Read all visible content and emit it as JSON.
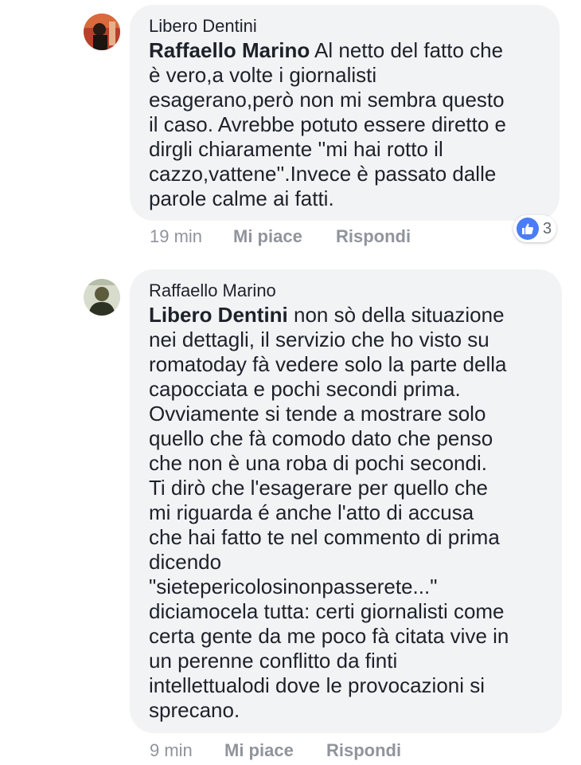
{
  "comments": [
    {
      "author": "Libero Dentini",
      "mention": "Raffaello Marino",
      "text": "Al netto del fatto che\nè vero,a volte i giornalisti\nesagerano,però non mi sembra questo\nil caso. Avrebbe potuto essere diretto e\ndirgli chiaramente ''mi hai rotto il\ncazzo,vattene''.Invece è passato dalle\nparole calme ai fatti.",
      "time": "19 min",
      "like_label": "Mi piace",
      "reply_label": "Rispondi",
      "reaction_count": "3"
    },
    {
      "author": "Raffaello Marino",
      "mention": "Libero Dentini",
      "text": "non sò della situazione\nnei dettagli, il servizio che ho visto su\nromatoday fà vedere solo la parte della\ncapocciata e pochi secondi prima.\nOvviamente si tende a mostrare solo\nquello che fà comodo dato che penso\nche non è una roba di pochi secondi.\nTi dirò che l'esagerare per quello che\nmi riguarda é anche l'atto di accusa\nche hai fatto te nel commento di prima\ndicendo\n\"sietepericolosinonpasserete...\"\ndiciamocela tutta: certi giornalisti come\ncerta gente da me poco fà citata vive in\nun perenne conflitto da finti\nintellettualodi dove le provocazioni si\nsprecano.",
      "time": "9 min",
      "like_label": "Mi piace",
      "reply_label": "Rispondi"
    }
  ],
  "colors": {
    "bubble": "#f2f3f5",
    "meta_text": "#90949c",
    "like_blue": "#4a7cf7"
  }
}
